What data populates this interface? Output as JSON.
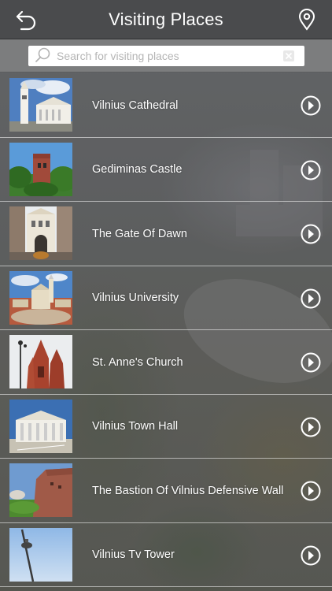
{
  "header": {
    "title": "Visiting Places"
  },
  "search": {
    "placeholder": "Search for visiting places",
    "value": ""
  },
  "places": [
    {
      "name": "Vilnius Cathedral",
      "thumb_icon": "cathedral-photo"
    },
    {
      "name": "Gediminas Castle",
      "thumb_icon": "castle-photo"
    },
    {
      "name": "The Gate Of Dawn",
      "thumb_icon": "gate-photo"
    },
    {
      "name": "Vilnius University",
      "thumb_icon": "university-photo"
    },
    {
      "name": "St. Anne's Church",
      "thumb_icon": "church-photo"
    },
    {
      "name": "Vilnius Town Hall",
      "thumb_icon": "town-hall-photo"
    },
    {
      "name": "The Bastion Of Vilnius Defensive Wall",
      "thumb_icon": "bastion-photo"
    },
    {
      "name": "Vilnius Tv Tower",
      "thumb_icon": "tv-tower-photo"
    }
  ],
  "colors": {
    "topbar": "#4a4b4d",
    "searchbar": "#7c7d7e",
    "text": "#ffffff"
  }
}
